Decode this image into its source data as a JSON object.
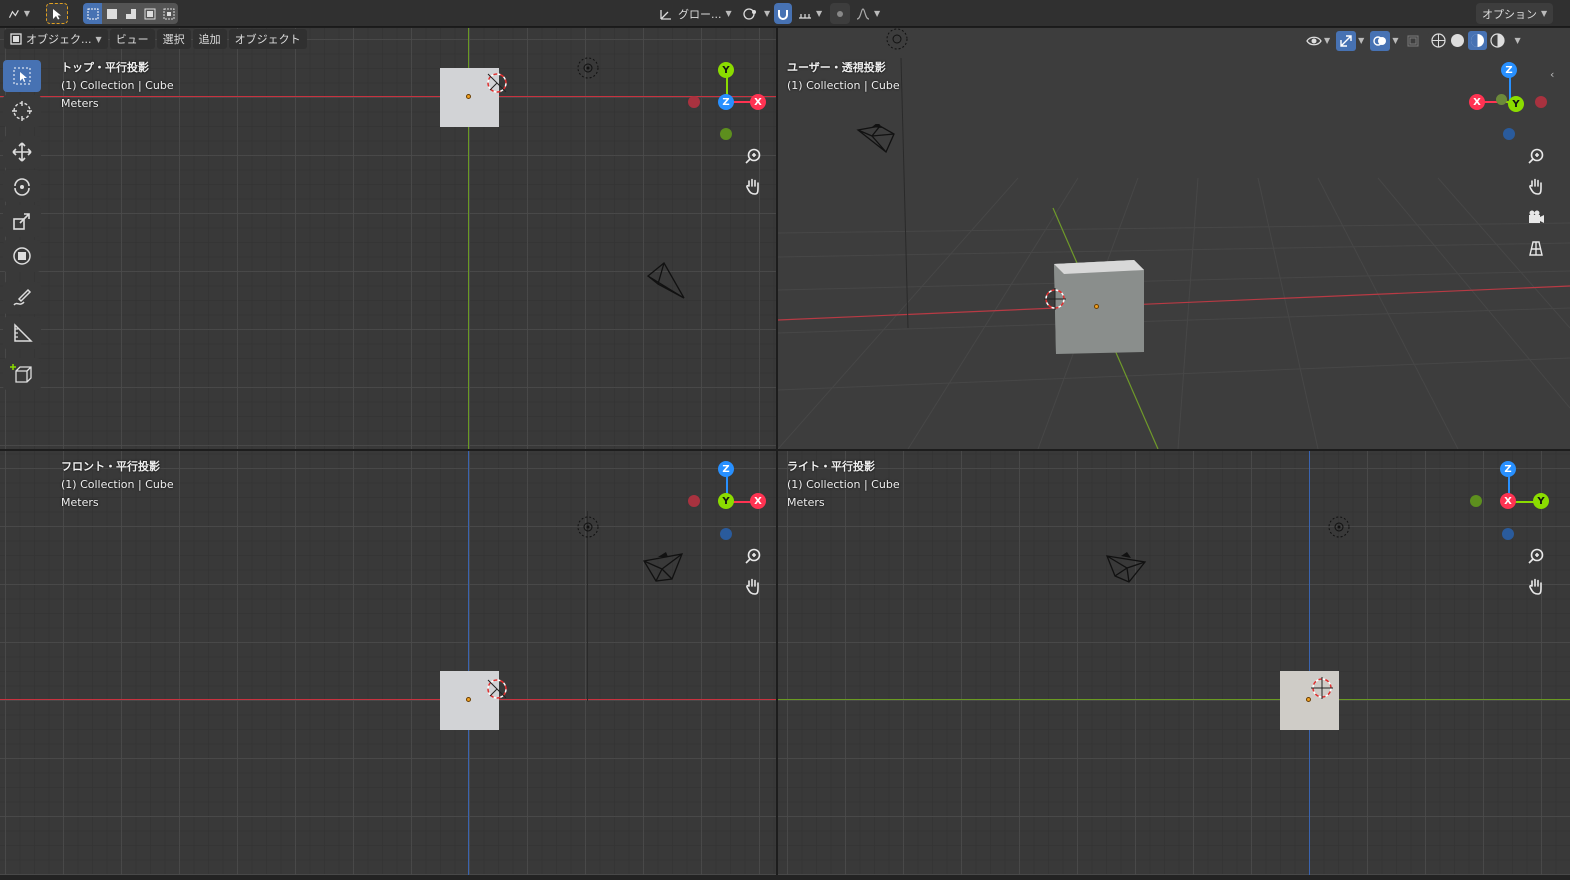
{
  "header": {
    "transform_orientation": "グロー...",
    "options_label": "オプション"
  },
  "viewport_menu": {
    "mode": "オブジェク...",
    "view": "ビュー",
    "select": "選択",
    "add": "追加",
    "object": "オブジェクト"
  },
  "viewports": {
    "top": {
      "title": "トップ・平行投影",
      "collection": "(1) Collection | Cube",
      "units": "Meters"
    },
    "user": {
      "title": "ユーザー・透視投影",
      "collection": "(1) Collection | Cube"
    },
    "front": {
      "title": "フロント・平行投影",
      "collection": "(1) Collection | Cube",
      "units": "Meters"
    },
    "right": {
      "title": "ライト・平行投影",
      "collection": "(1) Collection | Cube",
      "units": "Meters"
    }
  },
  "gizmo_labels": {
    "x": "X",
    "y": "Y",
    "z": "Z"
  },
  "colors": {
    "x_axis": "#ff3352",
    "y_axis": "#8bdc00",
    "z_axis": "#2890ff",
    "active_tool": "#4772b3",
    "viewport_bg": "#393939"
  },
  "icons": {
    "zoom": "zoom-icon",
    "pan": "hand-icon",
    "camera": "camera-icon",
    "grid": "grid-icon"
  }
}
